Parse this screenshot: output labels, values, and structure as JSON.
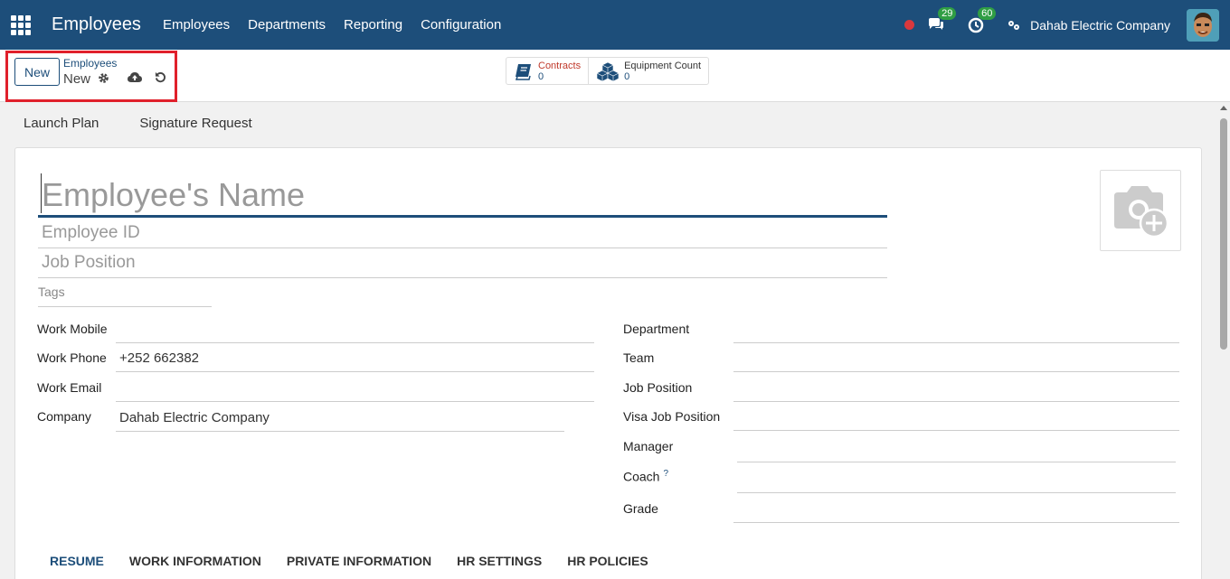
{
  "navbar": {
    "app_title": "Employees",
    "menu": [
      {
        "label": "Employees"
      },
      {
        "label": "Departments"
      },
      {
        "label": "Reporting"
      },
      {
        "label": "Configuration"
      }
    ],
    "messages_badge": "29",
    "activities_badge": "60",
    "company_name": "Dahab Electric Company"
  },
  "control_panel": {
    "new_button": "New",
    "breadcrumb_parent": "Employees",
    "breadcrumb_current": "New",
    "smart_buttons": [
      {
        "label": "Contracts",
        "value": "0"
      },
      {
        "label": "Equipment Count",
        "value": "0"
      }
    ]
  },
  "statusbar": {
    "buttons": [
      "Launch Plan",
      "Signature Request"
    ]
  },
  "form": {
    "name_placeholder": "Employee's Name",
    "employee_id_placeholder": "Employee ID",
    "job_position_placeholder": "Job Position",
    "tags_placeholder": "Tags",
    "left_fields": [
      {
        "label": "Work Mobile",
        "value": ""
      },
      {
        "label": "Work Phone",
        "value": "+252 662382"
      },
      {
        "label": "Work Email",
        "value": ""
      },
      {
        "label": "Company",
        "value": "Dahab Electric Company"
      }
    ],
    "right_fields": [
      {
        "label": "Department",
        "value": ""
      },
      {
        "label": "Team",
        "value": ""
      },
      {
        "label": "Job Position",
        "value": ""
      },
      {
        "label": "Visa Job Position",
        "value": ""
      },
      {
        "label": "Manager",
        "value": ""
      },
      {
        "label": "Coach",
        "value": "",
        "help": "?"
      },
      {
        "label": "Grade",
        "value": ""
      }
    ],
    "tabs": [
      {
        "label": "RESUME"
      },
      {
        "label": "WORK INFORMATION"
      },
      {
        "label": "PRIVATE INFORMATION"
      },
      {
        "label": "HR SETTINGS"
      },
      {
        "label": "HR POLICIES"
      }
    ]
  }
}
